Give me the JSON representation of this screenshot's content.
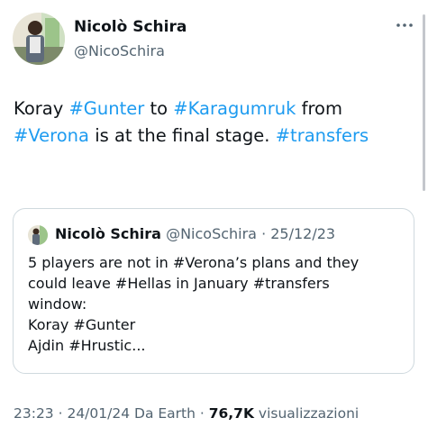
{
  "author": {
    "name": "Nicolò Schira",
    "handle": "@NicoSchira"
  },
  "icons": {
    "more": "more-horizontal-icon"
  },
  "tweet": {
    "p1": "Koray ",
    "t1": "#Gunter",
    "p2": " to ",
    "t2": "#Karagumruk",
    "p3": " from",
    "t3": "#Verona",
    "p4": " is at the final stage. ",
    "t4": "#transfers"
  },
  "quote": {
    "name": "Nicolò Schira",
    "handle": "@NicoSchira",
    "sep": " · ",
    "date": "25/12/23",
    "lines": [
      "5 players are not in #Verona’s plans and they",
      "could leave #Hellas in January #transfers",
      "window:",
      "Koray #Gunter",
      "Ajdin #Hrustic..."
    ]
  },
  "meta": {
    "time": "23:23",
    "sep": " · ",
    "date": "24/01/24",
    "source": " Da Earth",
    "views": "76,7K",
    "views_label": " visualizzazioni"
  },
  "colors": {
    "link": "#1d9bf0",
    "muted": "#536471",
    "text": "#0f1419",
    "border": "#cfd9de"
  }
}
